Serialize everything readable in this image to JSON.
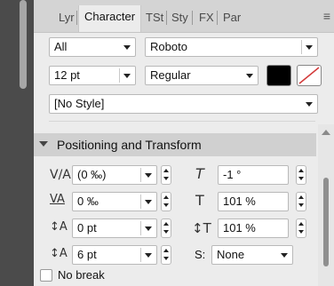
{
  "tabs": [
    {
      "label": "Lyr"
    },
    {
      "label": "Character"
    },
    {
      "label": "TSt"
    },
    {
      "label": "Sty"
    },
    {
      "label": "FX"
    },
    {
      "label": "Par"
    }
  ],
  "menu_icon": "≡",
  "font": {
    "collection": "All",
    "family": "Roboto",
    "size": "12 pt",
    "weight": "Regular",
    "fill_color": "#000000",
    "stroke_icon": "none-slash",
    "style": "[No Style]"
  },
  "section": {
    "title": "Positioning and Transform"
  },
  "positioning": {
    "kerning": "(0 ‰)",
    "tracking": "0 ‰",
    "baseline": "0 pt",
    "leading": "6 pt",
    "skew": "-1 °",
    "h_scale": "101 %",
    "v_scale": "101 %",
    "script_label": "S:",
    "script": "None"
  },
  "no_break_label": "No break",
  "colors": {
    "accent_red": "#d33a3a",
    "black": "#000000"
  }
}
